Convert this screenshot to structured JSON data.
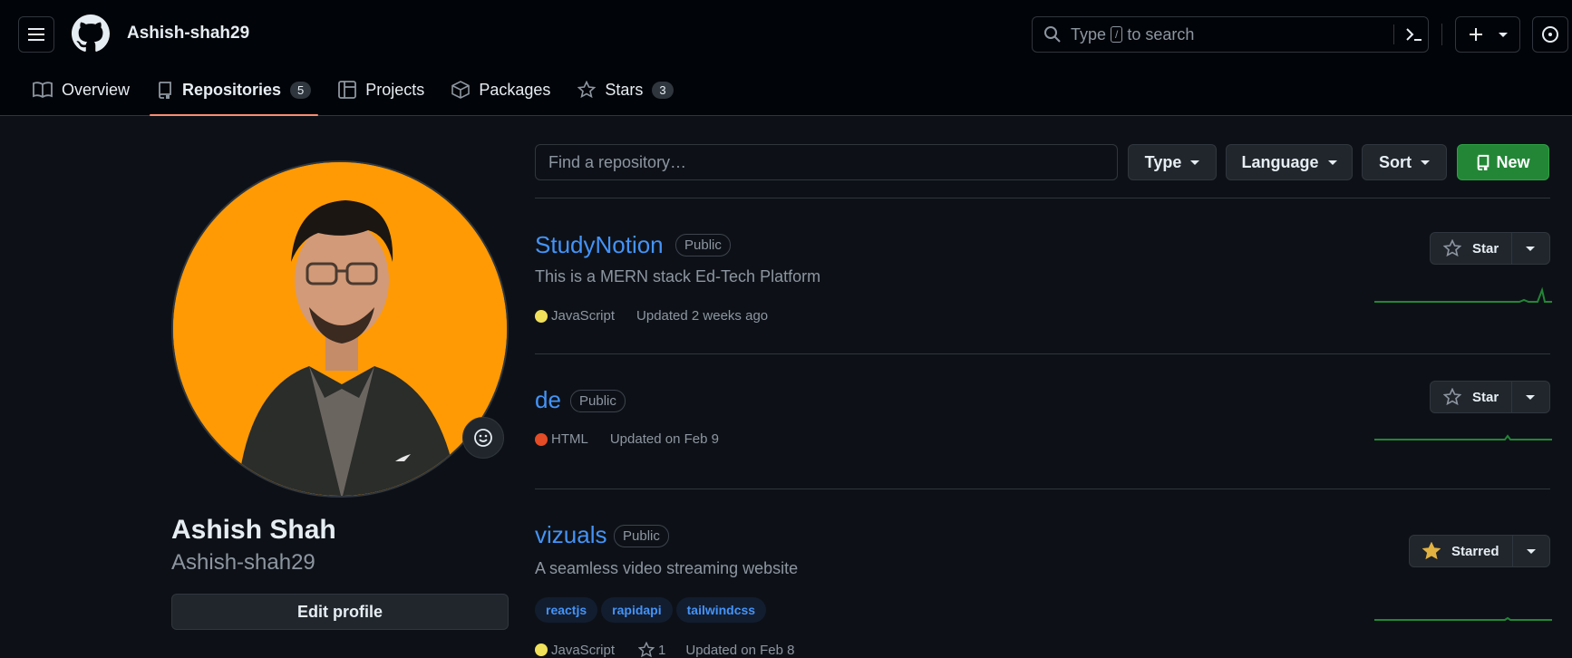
{
  "header": {
    "username": "Ashish-shah29",
    "search": {
      "before": "Type",
      "key": "/",
      "after": "to search"
    }
  },
  "nav": [
    {
      "label": "Overview",
      "icon": "book-icon"
    },
    {
      "label": "Repositories",
      "icon": "repo-icon",
      "count": "5",
      "active": true
    },
    {
      "label": "Projects",
      "icon": "table-icon"
    },
    {
      "label": "Packages",
      "icon": "package-icon"
    },
    {
      "label": "Stars",
      "icon": "star-icon",
      "count": "3"
    }
  ],
  "profile": {
    "name": "Ashish Shah",
    "login": "Ashish-shah29",
    "edit_label": "Edit profile",
    "avatar_bg": "#ff9a05"
  },
  "filters": {
    "placeholder": "Find a repository…",
    "type": "Type",
    "language": "Language",
    "sort": "Sort",
    "new": "New"
  },
  "repos": [
    {
      "name": "StudyNotion",
      "visibility": "Public",
      "description": "This is a MERN stack Ed-Tech Platform",
      "language": "JavaScript",
      "lang_color": "#f1e05a",
      "updated": "Updated 2 weeks ago",
      "star_label": "Star"
    },
    {
      "name": "de",
      "visibility": "Public",
      "language": "HTML",
      "lang_color": "#e34c26",
      "updated": "Updated on Feb 9",
      "star_label": "Star"
    },
    {
      "name": "vizuals",
      "visibility": "Public",
      "description": "A seamless video streaming website",
      "topics": [
        "reactjs",
        "rapidapi",
        "tailwindcss"
      ],
      "language": "JavaScript",
      "lang_color": "#f1e05a",
      "stars": "1",
      "updated": "Updated on Feb 8",
      "star_label": "Starred"
    }
  ]
}
